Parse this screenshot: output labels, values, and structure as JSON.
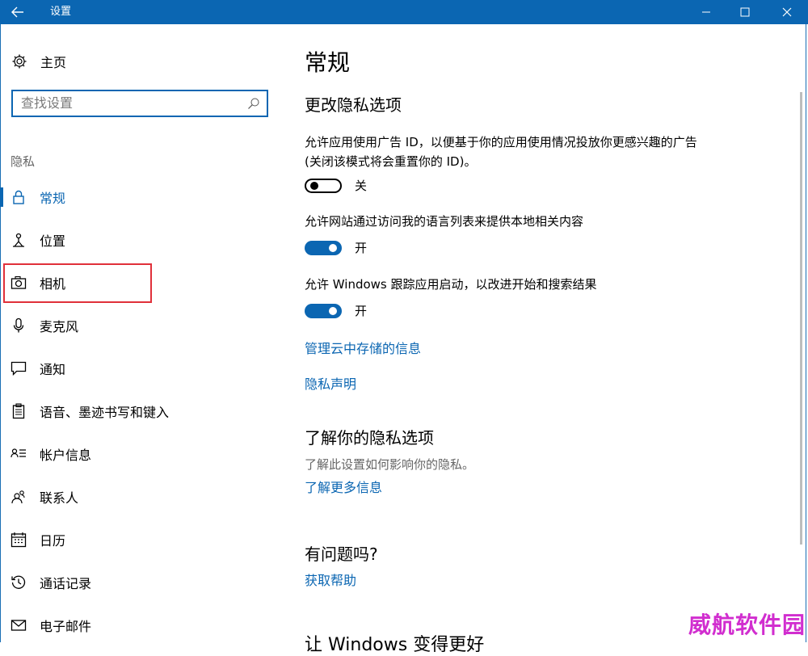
{
  "window": {
    "title": "设置"
  },
  "sidebar": {
    "home_label": "主页",
    "search_placeholder": "查找设置",
    "section_label": "隐私",
    "items": [
      {
        "label": "常规",
        "icon": "lock-icon"
      },
      {
        "label": "位置",
        "icon": "location-icon"
      },
      {
        "label": "相机",
        "icon": "camera-icon"
      },
      {
        "label": "麦克风",
        "icon": "microphone-icon"
      },
      {
        "label": "通知",
        "icon": "notification-icon"
      },
      {
        "label": "语音、墨迹书写和键入",
        "icon": "clipboard-icon"
      },
      {
        "label": "帐户信息",
        "icon": "account-info-icon"
      },
      {
        "label": "联系人",
        "icon": "contacts-icon"
      },
      {
        "label": "日历",
        "icon": "calendar-icon"
      },
      {
        "label": "通话记录",
        "icon": "history-icon"
      },
      {
        "label": "电子邮件",
        "icon": "mail-icon"
      }
    ]
  },
  "main": {
    "title": "常规",
    "section1": "更改隐私选项",
    "option1": {
      "text": "允许应用使用广告 ID，以便基于你的应用使用情况投放你更感兴趣的广告(关闭该模式将会重置你的 ID)。",
      "state": "关"
    },
    "option2": {
      "text": "允许网站通过访问我的语言列表来提供本地相关内容",
      "state": "开"
    },
    "option3": {
      "text": "允许 Windows 跟踪应用启动，以改进开始和搜索结果",
      "state": "开"
    },
    "link1": "管理云中存储的信息",
    "link2": "隐私声明",
    "section2": "了解你的隐私选项",
    "section2_desc": "了解此设置如何影响你的隐私。",
    "link3": "了解更多信息",
    "section3": "有问题吗?",
    "link4": "获取帮助",
    "section4": "让 Windows 变得更好"
  },
  "watermark": "威航软件园",
  "colors": {
    "accent": "#0b66b2",
    "highlight": "#e0303a",
    "watermark": "#d12ecf"
  }
}
